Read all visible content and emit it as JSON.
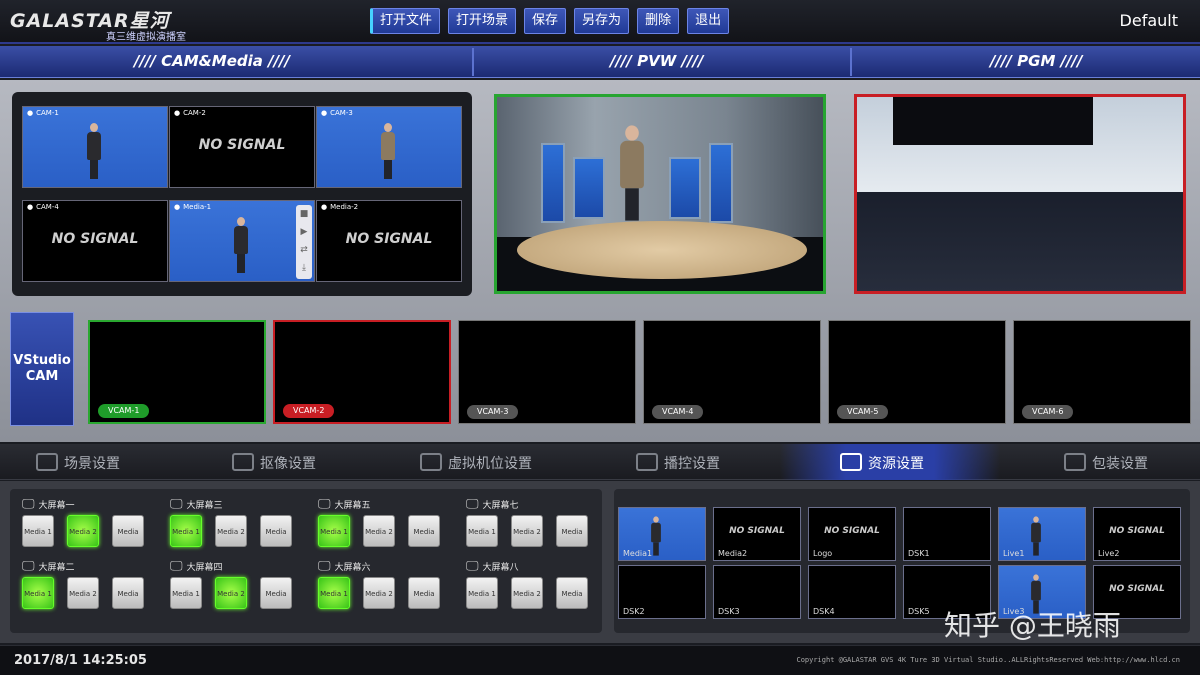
{
  "app": {
    "brand": "GALASTAR星河",
    "subtitle": "真三维虚拟演播室",
    "profile": "Default"
  },
  "file_menu": [
    "打开文件",
    "打开场景",
    "保存",
    "另存为",
    "删除",
    "退出"
  ],
  "sections": {
    "cam_media": "//// CAM&Media ////",
    "pvw": "//// PVW ////",
    "pgm": "//// PGM ////"
  },
  "cam_grid": [
    {
      "label": "CAM-1",
      "signal": "",
      "person": "dark"
    },
    {
      "label": "CAM-2",
      "signal": "NO SIGNAL",
      "person": ""
    },
    {
      "label": "CAM-3",
      "signal": "",
      "person": "khaki"
    },
    {
      "label": "CAM-4",
      "signal": "NO SIGNAL",
      "person": ""
    },
    {
      "label": "Media-1",
      "signal": "",
      "person": "dark"
    },
    {
      "label": "Media-2",
      "signal": "NO SIGNAL",
      "person": ""
    }
  ],
  "vstudio": {
    "label": "VStudio CAM",
    "cams": [
      "VCAM-1",
      "VCAM-2",
      "VCAM-3",
      "VCAM-4",
      "VCAM-5",
      "VCAM-6"
    ]
  },
  "tabs": [
    "场景设置",
    "抠像设置",
    "虚拟机位设置",
    "播控设置",
    "资源设置",
    "包装设置"
  ],
  "active_tab": "资源设置",
  "screens": [
    {
      "title": "大屏幕一",
      "buttons": [
        "Media 1",
        "Media 2",
        "Media"
      ],
      "active": 1
    },
    {
      "title": "大屏幕三",
      "buttons": [
        "Media 1",
        "Media 2",
        "Media"
      ],
      "active": 0
    },
    {
      "title": "大屏幕五",
      "buttons": [
        "Media 1",
        "Media 2",
        "Media"
      ],
      "active": 0
    },
    {
      "title": "大屏幕七",
      "buttons": [
        "Media 1",
        "Media 2",
        "Media"
      ],
      "active": -1
    },
    {
      "title": "大屏幕二",
      "buttons": [
        "Media 1",
        "Media 2",
        "Media"
      ],
      "active": 0
    },
    {
      "title": "大屏幕四",
      "buttons": [
        "Media 1",
        "Media 2",
        "Media"
      ],
      "active": 1
    },
    {
      "title": "大屏幕六",
      "buttons": [
        "Media 1",
        "Media 2",
        "Media"
      ],
      "active": 0
    },
    {
      "title": "大屏幕八",
      "buttons": [
        "Media 1",
        "Media 2",
        "Media"
      ],
      "active": -1
    }
  ],
  "sources": [
    {
      "label": "Media1",
      "signal": "",
      "feed": true
    },
    {
      "label": "Media2",
      "signal": "NO SIGNAL",
      "feed": false
    },
    {
      "label": "Logo",
      "signal": "NO SIGNAL",
      "feed": false
    },
    {
      "label": "DSK1",
      "signal": "",
      "feed": false
    },
    {
      "label": "Live1",
      "signal": "",
      "feed": true
    },
    {
      "label": "Live2",
      "signal": "NO SIGNAL",
      "feed": false
    },
    {
      "label": "DSK2",
      "signal": "",
      "feed": false
    },
    {
      "label": "DSK3",
      "signal": "",
      "feed": false
    },
    {
      "label": "DSK4",
      "signal": "",
      "feed": false
    },
    {
      "label": "DSK5",
      "signal": "",
      "feed": false
    },
    {
      "label": "Live3",
      "signal": "",
      "feed": true
    },
    {
      "label": "",
      "signal": "NO SIGNAL",
      "feed": false
    }
  ],
  "watermark": "知乎 @王晓雨",
  "status": {
    "datetime": "2017/8/1 14:25:05",
    "copyright": "Copyright @GALASTAR GVS 4K Ture 3D Virtual Studio..ALLRightsReserved Web:http://www.hlcd.cn"
  },
  "colors": {
    "accent": "#2a3fa6",
    "pvw_border": "#27a531",
    "pgm_border": "#c81e24",
    "active_button": "#37c417"
  }
}
